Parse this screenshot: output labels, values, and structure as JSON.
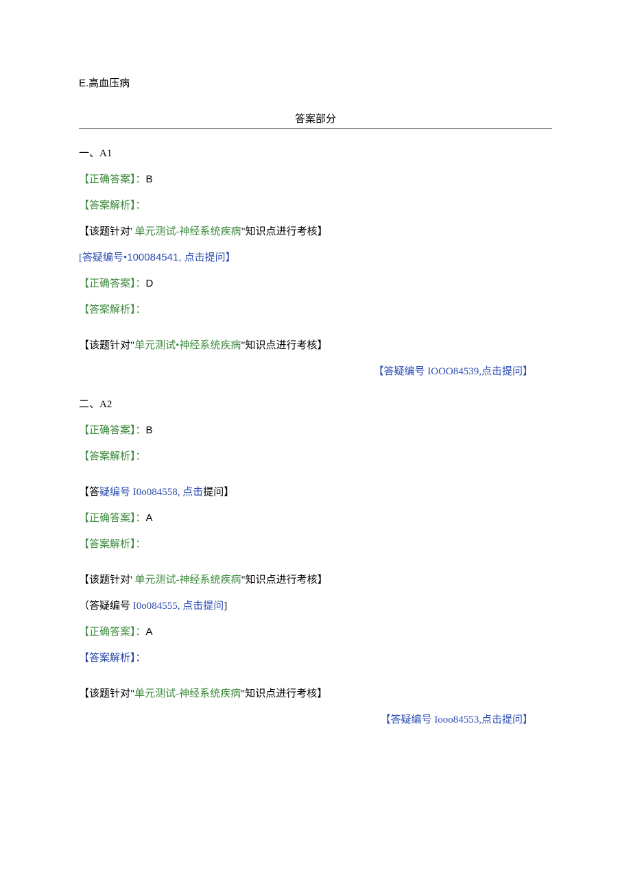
{
  "top": {
    "option_e": "E.高血压病"
  },
  "answers_header": "答案部分",
  "section1": {
    "label": "一、A1",
    "q1": {
      "correct_prefix": "【正确答案】：",
      "correct_value": "B",
      "analysis_label": "【答案解析】：",
      "knowledge_prefix": "【该题针对'",
      "knowledge_green": " 单元测试-神经系统疾病",
      "knowledge_suffix": "\"知识点进行考核】",
      "ref_prefix": "[答疑编号•",
      "ref_id": "100084541, 点击提问",
      "ref_suffix": "】"
    },
    "q2": {
      "correct_prefix": "【正确答案】：",
      "correct_value": "D",
      "analysis_label": "【答案解析】：",
      "knowledge_prefix": "【该题针对\"",
      "knowledge_green": "单元测试•神经系统疾病",
      "knowledge_suffix": "\"知识点进行考核】",
      "ref_full": "【答疑编号 IOOO84539,点击提问】"
    }
  },
  "section2": {
    "label": "二、A2",
    "q1": {
      "correct_prefix": "【正确答案】：",
      "correct_value": "B",
      "analysis_label": "【答案解析】：",
      "ref_prefix_black": "【答",
      "ref_blue": "疑编号 I0o084558, 点击",
      "ref_suffix_black": "提问】"
    },
    "q2": {
      "correct_prefix": "【正确答案】：",
      "correct_value": "A",
      "analysis_label": "【答案解析】：",
      "knowledge_prefix": "【该题针对'",
      "knowledge_green": " 单元测试-神经系统疾病",
      "knowledge_suffix": "\"知识点进行考核】",
      "ref_prefix": "（答疑编号 ",
      "ref_id": "I0o084555, 点击提问",
      "ref_suffix": "]"
    },
    "q3": {
      "correct_prefix": "【正确答案】：",
      "correct_value": "A",
      "analysis_label": "【答案解析】：",
      "knowledge_prefix": "【该题针对\"",
      "knowledge_green": "单元测试-神经系统疾病",
      "knowledge_suffix": "\"知识点进行考核】",
      "ref_full": "【答疑编号 Iooo84553,点击提问】"
    }
  }
}
